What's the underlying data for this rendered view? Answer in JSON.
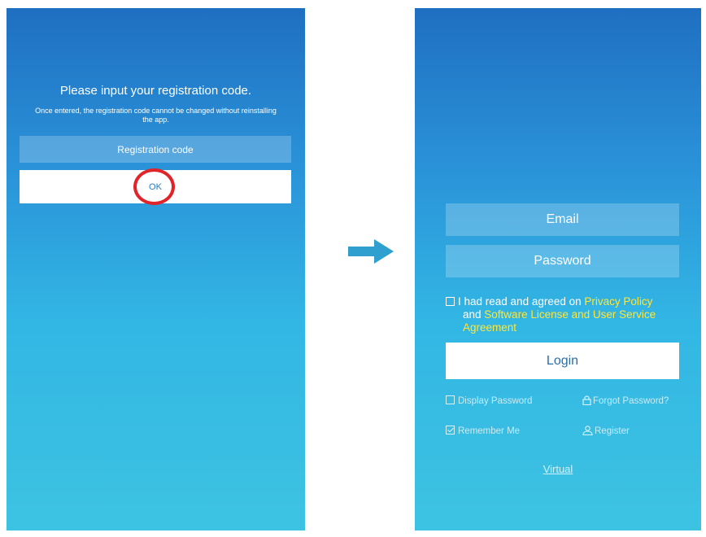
{
  "registration": {
    "title": "Please input your registration code.",
    "note": "Once entered, the registration code cannot be changed without reinstalling the app.",
    "code_placeholder": "Registration code",
    "ok_label": "OK"
  },
  "login": {
    "email_placeholder": "Email",
    "password_placeholder": "Password",
    "agree_prefix": "I had read and agreed on",
    "privacy_policy": "Privacy Policy",
    "and_text": "and",
    "software_license": "Software License and User Service Agreement",
    "login_label": "Login",
    "display_password": "Display Password",
    "forgot_password": "Forgot Password?",
    "remember_me": "Remember Me",
    "register": "Register",
    "virtual": "Virtual",
    "remember_me_checked": true,
    "display_password_checked": false,
    "agree_checked": false
  },
  "icons": {
    "arrow": "right-arrow-icon",
    "lock": "lock-icon",
    "user": "user-icon"
  },
  "colors": {
    "gradient_top": "#1f6fc1",
    "gradient_bottom": "#3dc3e2",
    "link_yellow": "#ffe63a",
    "highlight_red": "#e0242a",
    "arrow": "#2f9fd0"
  }
}
